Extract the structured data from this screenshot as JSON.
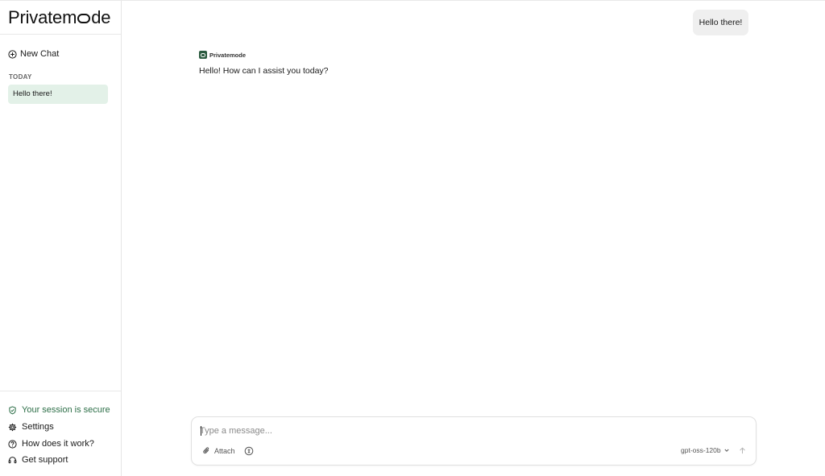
{
  "sidebar": {
    "logo_text_left": "Privatem",
    "logo_text_right": "de",
    "new_chat_label": "New Chat",
    "section_label": "TODAY",
    "chats": [
      {
        "label": "Hello there!",
        "active": true
      }
    ],
    "bottom_links": [
      {
        "label": "Your session is secure",
        "icon": "shield-check-icon"
      },
      {
        "label": "Settings",
        "icon": "gear-icon"
      },
      {
        "label": "How does it work?",
        "icon": "question-circle-icon"
      },
      {
        "label": "Get support",
        "icon": "headset-icon"
      }
    ]
  },
  "conversation": {
    "user_message": "Hello there!",
    "assistant_name": "Privatemode",
    "assistant_message": "Hello! How can I assist you today?"
  },
  "composer": {
    "placeholder": "Type a message...",
    "value": "",
    "attach_label": "Attach",
    "model": "gpt-oss-120b"
  },
  "colors": {
    "accent_green": "#2c6e47",
    "active_chat_bg": "#e3f1e8",
    "user_bubble_bg": "#efefef"
  }
}
